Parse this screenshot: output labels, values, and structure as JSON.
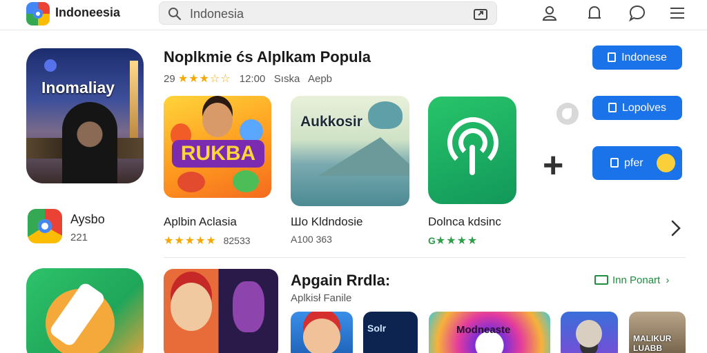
{
  "header": {
    "brand": "Indoneesia",
    "search_value": "Indonesia",
    "icons": [
      "search-icon",
      "share-icon",
      "account-icon",
      "notifications-icon",
      "chat-icon",
      "menu-icon"
    ]
  },
  "hero": {
    "title": "Inomaliay"
  },
  "featured": {
    "title": "Noplkmie ćs Alplkam Popula",
    "rating_prefix": "29",
    "rating_stars": "★★★☆☆",
    "meta": "12:00   Sıska   Aepb",
    "apps": [
      {
        "name": "Aplbin Aclasia",
        "stars": "★★★★★",
        "sub": "82533",
        "art_text": "RUKBA"
      },
      {
        "name": "Шo Kldndosie",
        "stars": "",
        "sub": "A100  363",
        "art_text": "Aukkosir"
      },
      {
        "name": "Dolnca kdsinc",
        "stars": "★★★★",
        "sub": "G",
        "art_text": ""
      }
    ]
  },
  "side_app": {
    "name": "Aysbo",
    "sub": "221"
  },
  "actions": {
    "button1": "Indonese",
    "button2": "Lopolves",
    "button3": "pfer"
  },
  "second_section": {
    "title": "Apgain Rrdla:",
    "subtitle": "Aplkisł Fanile",
    "see_more": "Inn Ponart",
    "tiles": [
      {
        "label": ""
      },
      {
        "label": "Solr"
      },
      {
        "label": "Modneaste"
      },
      {
        "label": ""
      },
      {
        "label": "MALIKUR\nLUABB"
      }
    ]
  },
  "colors": {
    "accent_blue": "#1a73e8",
    "star_gold": "#f6a800",
    "link_green": "#1e8e3e"
  }
}
